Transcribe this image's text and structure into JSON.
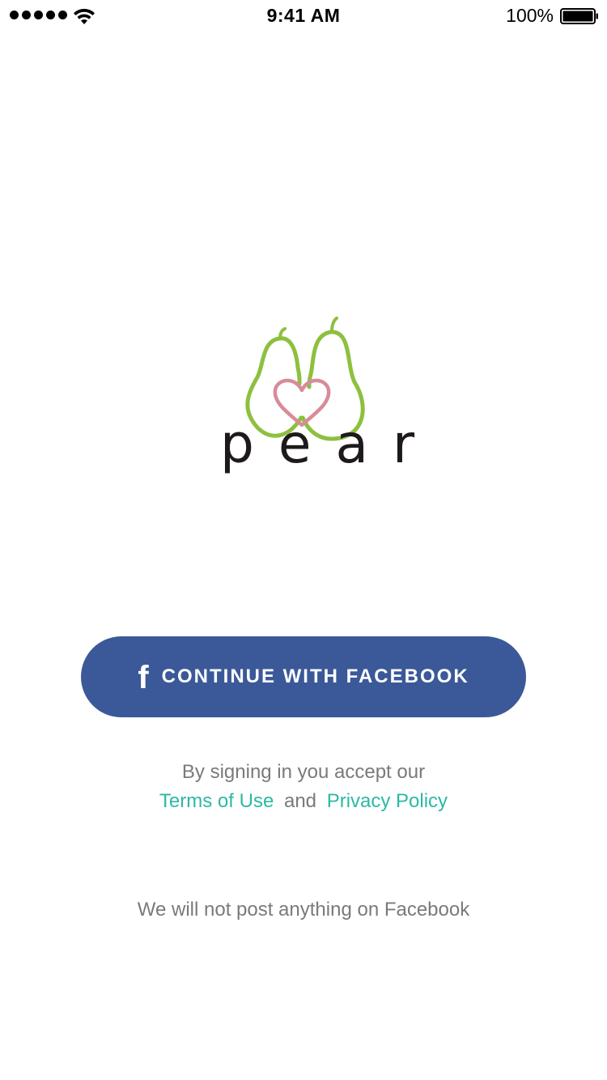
{
  "status_bar": {
    "time": "9:41 AM",
    "battery_percent": "100%",
    "signal_icon": "signal-dots-icon",
    "wifi_icon": "wifi-icon",
    "battery_icon": "battery-icon"
  },
  "logo": {
    "icon": "pear-heart-logo-icon",
    "wordmark": "pear",
    "colors": {
      "pear": "#8dc03f",
      "heart": "#d88b99",
      "wordmark": "#1e1a1b"
    }
  },
  "login": {
    "facebook_icon": "f",
    "facebook_button_label": "CONTINUE WITH FACEBOOK",
    "button_color": "#3b5998"
  },
  "legal": {
    "line1": "By signing in you accept our",
    "terms_link": "Terms of Use",
    "and_text": "and",
    "privacy_link": "Privacy Policy",
    "link_color": "#2cb9a5"
  },
  "footer": {
    "no_post_notice": "We will not post anything on Facebook"
  }
}
